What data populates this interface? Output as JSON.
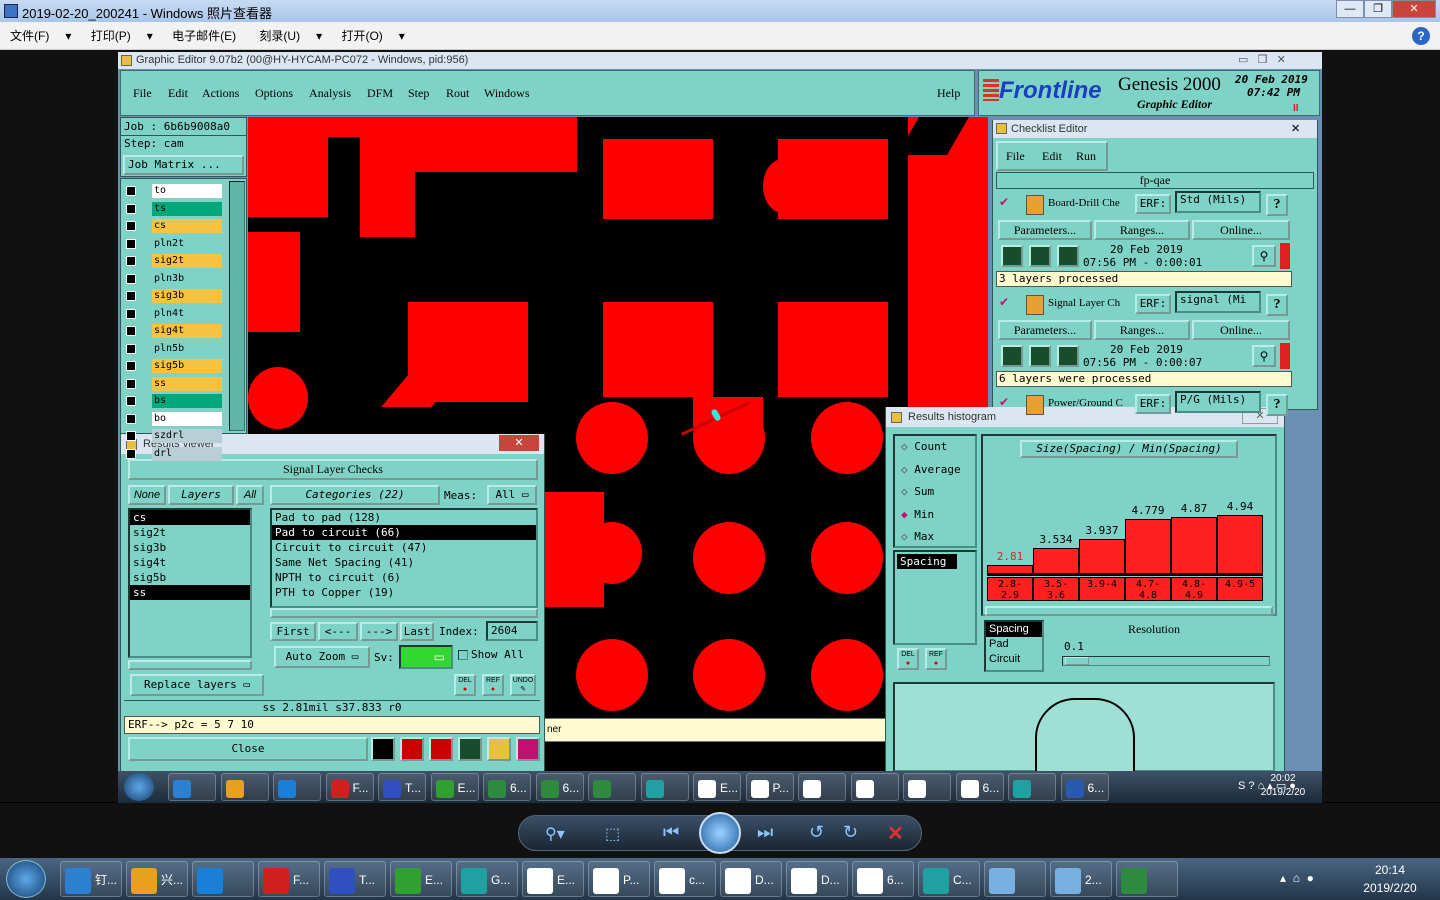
{
  "outer": {
    "title": "2019-02-20_200241 - Windows 照片查看器",
    "menu": [
      "文件(F)",
      "打印(P)",
      "电子邮件(E)",
      "刻录(U)",
      "打开(O)"
    ],
    "help": "?"
  },
  "ge": {
    "title": "Graphic Editor 9.07b2 (00@HY-HYCAM-PC072 - Windows, pid:956)",
    "menu": [
      "File",
      "Edit",
      "Actions",
      "Options",
      "Analysis",
      "DFM",
      "Step",
      "Rout",
      "Windows"
    ],
    "help": "Help",
    "brand": "Frontline",
    "product": "Genesis 2000",
    "subtitle": "Graphic Editor",
    "date": "20 Feb 2019",
    "time": "07:42 PM"
  },
  "job": {
    "job": "Job : 6b6b9008a0",
    "step": "Step: cam",
    "matrix": "Job Matrix ..."
  },
  "layers": [
    {
      "name": "to",
      "color": "#ffffff"
    },
    {
      "name": "ts",
      "color": "#00a87a"
    },
    {
      "name": "cs",
      "color": "#f5c242"
    },
    {
      "name": "pln2t",
      "color": "#7fd3c6"
    },
    {
      "name": "sig2t",
      "color": "#f5c242"
    },
    {
      "name": "pln3b",
      "color": "#7fd3c6"
    },
    {
      "name": "sig3b",
      "color": "#f5c242"
    },
    {
      "name": "pln4t",
      "color": "#7fd3c6"
    },
    {
      "name": "sig4t",
      "color": "#f5c242"
    },
    {
      "name": "pln5b",
      "color": "#7fd3c6"
    },
    {
      "name": "sig5b",
      "color": "#f5c242"
    },
    {
      "name": "ss",
      "color": "#f5c242"
    },
    {
      "name": "bs",
      "color": "#00a87a"
    },
    {
      "name": "bo",
      "color": "#ffffff"
    },
    {
      "name": "szdrl",
      "color": "#b8cfd6"
    },
    {
      "name": "drl",
      "color": "#b8cfd6"
    }
  ],
  "results": {
    "title": "Results viewer",
    "header": "Signal Layer Checks",
    "none": "None",
    "layers_lbl": "Layers",
    "all": "All",
    "categories": "Categories (22)",
    "meas": "Meas:",
    "meas_val": "All",
    "layer_list": [
      "cs",
      "sig2t",
      "sig3b",
      "sig4t",
      "sig5b",
      "ss"
    ],
    "cat_list": [
      "Pad to pad (128)",
      "Pad to circuit (66)",
      "Circuit to circuit (47)",
      "Same Net Spacing (41)",
      "NPTH to circuit (6)",
      "PTH to Copper (19)"
    ],
    "first": "First",
    "prev": "<---",
    "next": "--->",
    "last": "Last",
    "index_lbl": "Index:",
    "index": "2604",
    "autozoom": "Auto Zoom",
    "sv": "Sv:",
    "showall": "Show All",
    "replace": "Replace layers",
    "status": "ss 2.81mil  s37.833  r0",
    "erf": "ERF--> p2c = 5 7 10",
    "close": "Close",
    "del": "DEL",
    "ref": "REF",
    "undo": "UNDO",
    "bottom": "ner"
  },
  "checklist": {
    "title": "Checklist Editor",
    "menu": [
      "File",
      "Edit",
      "Run"
    ],
    "name": "fp-qae",
    "items": [
      {
        "name": "Board-Drill Che",
        "erf": "ERF:",
        "erf_val": "Std (Mils)",
        "params": "Parameters...",
        "ranges": "Ranges...",
        "online": "Online...",
        "date": "20 Feb 2019",
        "time": "07:56 PM - 0:00:01",
        "msg": "3 layers processed"
      },
      {
        "name": "Signal Layer Ch",
        "erf": "ERF:",
        "erf_val": "signal (Mi",
        "params": "Parameters...",
        "ranges": "Ranges...",
        "online": "Online...",
        "date": "20 Feb 2019",
        "time": "07:56 PM - 0:00:07",
        "msg": "6 layers were processed"
      },
      {
        "name": "Power/Ground C",
        "erf": "ERF:",
        "erf_val": "P/G (Mils)"
      }
    ]
  },
  "histogram": {
    "title": "Results histogram",
    "options": [
      "Count",
      "Average",
      "Sum",
      "Min",
      "Max"
    ],
    "selected": "Min",
    "param": "Spacing",
    "chart_title": "Size(Spacing) / Min(Spacing)",
    "params2": [
      "Spacing",
      "Pad",
      "Circuit"
    ],
    "resolution_lbl": "Resolution",
    "resolution": "0.1"
  },
  "chart_data": {
    "type": "bar",
    "title": "Size(Spacing) / Min(Spacing)",
    "categories": [
      "2.8-2.9",
      "3.5-3.6",
      "3.9-4",
      "4.7-4.8",
      "4.8-4.9",
      "4.9-5"
    ],
    "values": [
      2.81,
      3.534,
      3.937,
      4.779,
      4.87,
      4.94
    ],
    "labels": [
      "2.81",
      "3.534",
      "3.937",
      "4.779",
      "4.87",
      "4.94"
    ],
    "highlight_index": 0,
    "ylim": [
      0,
      5
    ]
  },
  "taskbar1": {
    "items": [
      {
        "label": "",
        "color": "#2d7fd0"
      },
      {
        "label": "",
        "color": "#e8a020"
      },
      {
        "label": "",
        "color": "#1a7fd6"
      },
      {
        "label": "F...",
        "color": "#d02020"
      },
      {
        "label": "T...",
        "color": "#3050c0"
      },
      {
        "label": "E...",
        "color": "#30a030"
      },
      {
        "label": "6...",
        "color": "#2d8a3e"
      },
      {
        "label": "6...",
        "color": "#2d8a3e"
      },
      {
        "label": "",
        "color": "#2d8a3e"
      },
      {
        "label": "",
        "color": "#20a0a0"
      },
      {
        "label": "E...",
        "color": "#ffffff"
      },
      {
        "label": "P...",
        "color": "#ffffff"
      },
      {
        "label": "",
        "color": "#ffffff"
      },
      {
        "label": "",
        "color": "#ffffff"
      },
      {
        "label": "",
        "color": "#ffffff"
      },
      {
        "label": "6...",
        "color": "#ffffff"
      },
      {
        "label": "",
        "color": "#20a0a0"
      },
      {
        "label": "6...",
        "color": "#2a5ab0"
      }
    ],
    "time": "20:02",
    "date": "2019/2/20"
  },
  "taskbar2": {
    "items": [
      {
        "label": "钉...",
        "color": "#2d7fd0"
      },
      {
        "label": "兴...",
        "color": "#e8a020"
      },
      {
        "label": "",
        "color": "#1a7fd6"
      },
      {
        "label": "F...",
        "color": "#d02020"
      },
      {
        "label": "T...",
        "color": "#3050c0"
      },
      {
        "label": "E...",
        "color": "#30a030"
      },
      {
        "label": "G...",
        "color": "#20a0a0"
      },
      {
        "label": "E...",
        "color": "#ffffff"
      },
      {
        "label": "P...",
        "color": "#ffffff"
      },
      {
        "label": "c...",
        "color": "#ffffff"
      },
      {
        "label": "D...",
        "color": "#ffffff"
      },
      {
        "label": "D...",
        "color": "#ffffff"
      },
      {
        "label": "6...",
        "color": "#ffffff"
      },
      {
        "label": "C...",
        "color": "#20a0a0"
      },
      {
        "label": "",
        "color": "#7ab0e0"
      },
      {
        "label": "2...",
        "color": "#7ab0e0"
      },
      {
        "label": "",
        "color": "#2d8a3e"
      }
    ],
    "time": "20:14",
    "date": "2019/2/20"
  }
}
